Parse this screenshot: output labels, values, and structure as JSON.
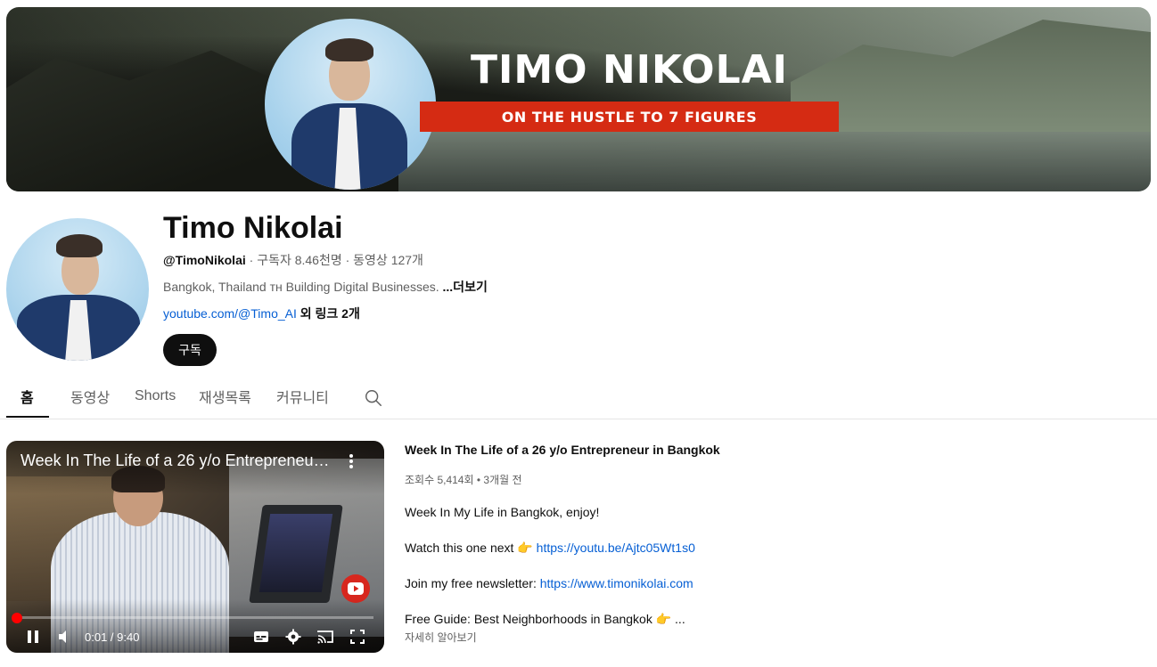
{
  "banner": {
    "title": "TIMO NIKOLAI",
    "ribbon": "ON THE HUSTLE TO 7 FIGURES"
  },
  "channel": {
    "name": "Timo Nikolai",
    "handle": "@TimoNikolai",
    "stats": " · 구독자 8.46천명 · 동영상 127개",
    "description": "Bangkok, Thailand ᴛʜ Building Digital Businesses. ",
    "more_label": "...더보기",
    "link": "youtube.com/@Timo_AI",
    "extra_links": " 외 링크 2개",
    "subscribe_label": "구독"
  },
  "tabs": [
    {
      "label": "홈",
      "active": true
    },
    {
      "label": "동영상",
      "active": false
    },
    {
      "label": "Shorts",
      "active": false
    },
    {
      "label": "재생목록",
      "active": false
    },
    {
      "label": "커뮤니티",
      "active": false
    }
  ],
  "player": {
    "title": "Week In The Life of a 26 y/o Entrepreneur in Bangkok",
    "time": "0:01 / 9:40",
    "progress": 0.002
  },
  "video": {
    "title": "Week In The Life of a 26 y/o Entrepreneur in Bangkok",
    "stats": "조회수 5,414회 • 3개월 전",
    "desc_line1": "Week In My Life in Bangkok, enjoy!",
    "desc_line2_text": "Watch this one next 👉 ",
    "desc_line2_link": "https://youtu.be/Ajtc05Wt1s0",
    "desc_line3_text": "Join my free newsletter: ",
    "desc_line3_link": "https://www.timonikolai.com",
    "desc_line4": "Free Guide: Best Neighborhoods in Bangkok 👉 ...",
    "learn_more": "자세히 알아보기"
  },
  "colors": {
    "ribbon": "#d52b13",
    "link": "#065fd4",
    "progress": "#ff0000"
  }
}
